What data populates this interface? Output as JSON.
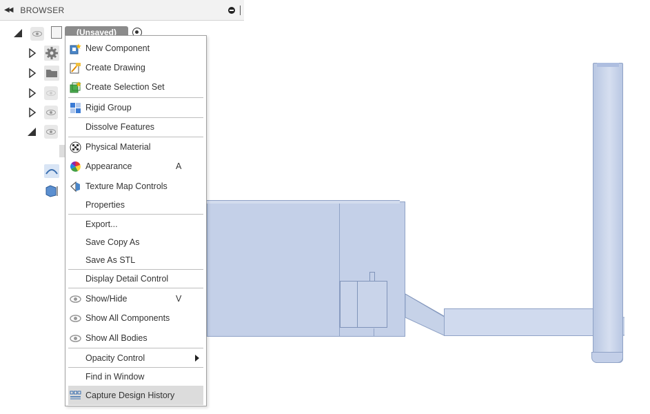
{
  "browser": {
    "title": "BROWSER",
    "root_label": "(Unsaved)"
  },
  "context_menu": {
    "items": [
      {
        "label": "New Component",
        "icon": "new-component-icon",
        "shortcut": ""
      },
      {
        "label": "Create Drawing",
        "icon": "create-drawing-icon",
        "shortcut": ""
      },
      {
        "label": "Create Selection Set",
        "icon": "selection-set-icon",
        "shortcut": ""
      },
      {
        "label": "Rigid Group",
        "icon": "rigid-group-icon",
        "shortcut": ""
      },
      {
        "label": "Dissolve Features",
        "icon": "",
        "shortcut": ""
      },
      {
        "label": "Physical Material",
        "icon": "physical-material-icon",
        "shortcut": ""
      },
      {
        "label": "Appearance",
        "icon": "appearance-icon",
        "shortcut": "A"
      },
      {
        "label": "Texture Map Controls",
        "icon": "texture-map-icon",
        "shortcut": ""
      },
      {
        "label": "Properties",
        "icon": "",
        "shortcut": ""
      },
      {
        "label": "Export...",
        "icon": "",
        "shortcut": ""
      },
      {
        "label": "Save Copy As",
        "icon": "",
        "shortcut": ""
      },
      {
        "label": "Save As STL",
        "icon": "",
        "shortcut": ""
      },
      {
        "label": "Display Detail Control",
        "icon": "",
        "shortcut": ""
      },
      {
        "label": "Show/Hide",
        "icon": "eye-icon",
        "shortcut": "V"
      },
      {
        "label": "Show All Components",
        "icon": "eye-icon",
        "shortcut": ""
      },
      {
        "label": "Show All Bodies",
        "icon": "eye-icon",
        "shortcut": ""
      },
      {
        "label": "Opacity Control",
        "icon": "",
        "shortcut": ""
      },
      {
        "label": "Find in Window",
        "icon": "",
        "shortcut": ""
      },
      {
        "label": "Capture Design History",
        "icon": "capture-history-icon",
        "shortcut": ""
      }
    ]
  },
  "colors": {
    "model_fill": "#c6d2e8",
    "model_edge": "#8fa2c6",
    "menu_highlight": "#dcdcdc"
  }
}
